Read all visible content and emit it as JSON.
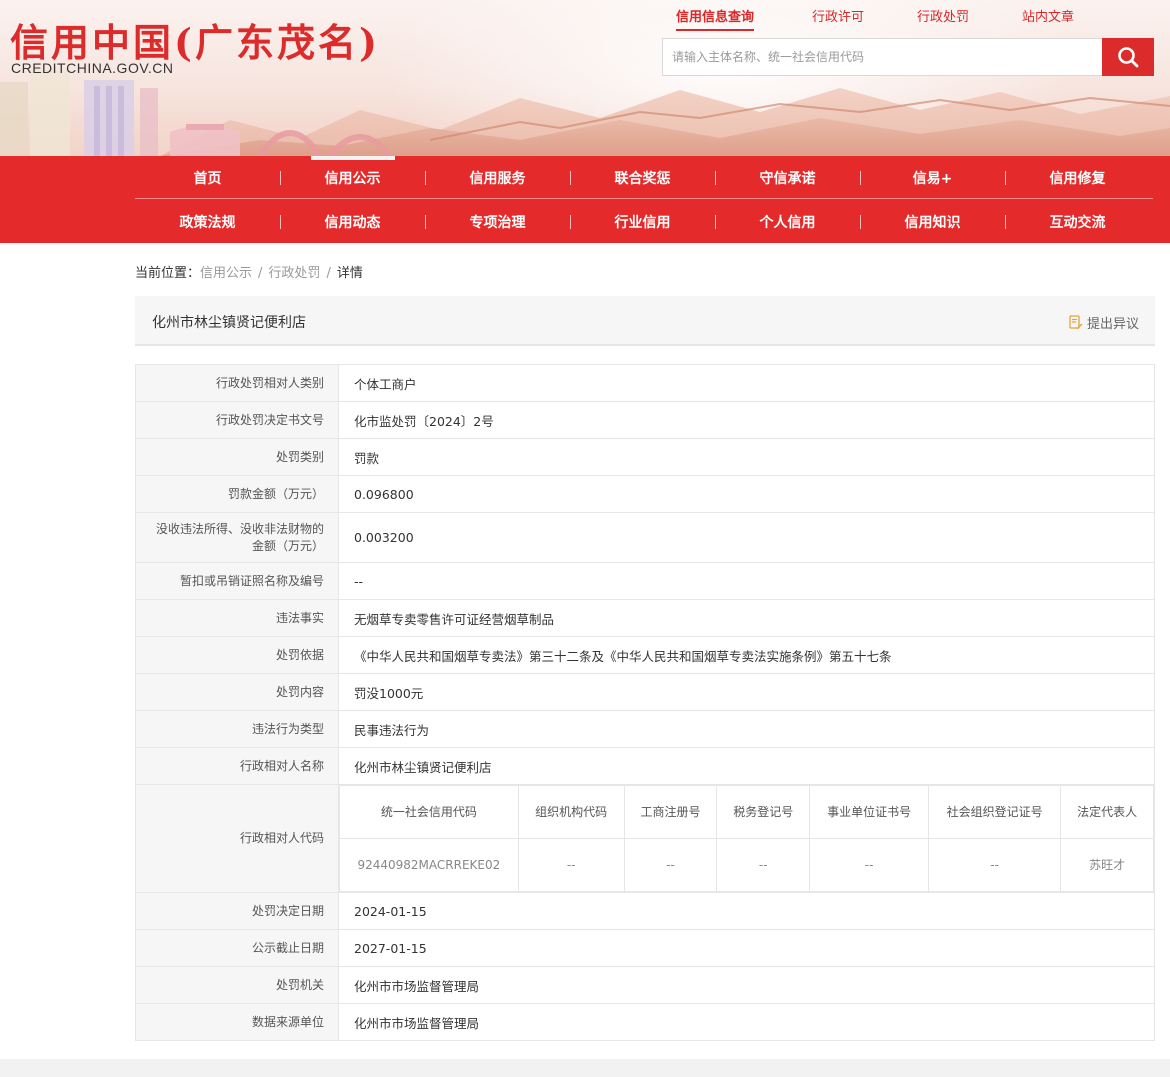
{
  "header": {
    "title": "信用中国(广东茂名)",
    "domain": "CREDITCHINA.GOV.CN",
    "top_links": [
      {
        "label": "信用信息查询",
        "active": true
      },
      {
        "label": "行政许可",
        "active": false
      },
      {
        "label": "行政处罚",
        "active": false
      },
      {
        "label": "站内文章",
        "active": false
      }
    ],
    "search": {
      "placeholder": "请输入主体名称、统一社会信用代码",
      "button_icon": "search-icon"
    }
  },
  "nav": {
    "row1": [
      "首页",
      "信用公示",
      "信用服务",
      "联合奖惩",
      "守信承诺",
      "信易+",
      "信用修复"
    ],
    "row2": [
      "政策法规",
      "信用动态",
      "专项治理",
      "行业信用",
      "个人信用",
      "信用知识",
      "互动交流"
    ],
    "active": "信用公示"
  },
  "breadcrumb": {
    "prefix": "当前位置：",
    "items": [
      "信用公示",
      "行政处罚",
      "详情"
    ]
  },
  "entity": {
    "name": "化州市林尘镇贤记便利店",
    "objection_label": "提出异议"
  },
  "details": {
    "rows_top": [
      {
        "label": "行政处罚相对人类别",
        "value": "个体工商户"
      },
      {
        "label": "行政处罚决定书文号",
        "value": "化市监处罚〔2024〕2号"
      },
      {
        "label": "处罚类别",
        "value": "罚款"
      },
      {
        "label": "罚款金额（万元）",
        "value": "0.096800"
      },
      {
        "label": "没收违法所得、没收非法财物的金额（万元）",
        "value": "0.003200"
      },
      {
        "label": "暂扣或吊销证照名称及编号",
        "value": "--"
      },
      {
        "label": "违法事实",
        "value": "无烟草专卖零售许可证经营烟草制品"
      },
      {
        "label": "处罚依据",
        "value": "《中华人民共和国烟草专卖法》第三十二条及《中华人民共和国烟草专卖法实施条例》第五十七条"
      },
      {
        "label": "处罚内容",
        "value": "罚没1000元"
      },
      {
        "label": "违法行为类型",
        "value": "民事违法行为"
      },
      {
        "label": "行政相对人名称",
        "value": "化州市林尘镇贤记便利店"
      }
    ],
    "code_block": {
      "label": "行政相对人代码",
      "headers": [
        "统一社会信用代码",
        "组织机构代码",
        "工商注册号",
        "税务登记号",
        "事业单位证书号",
        "社会组织登记证号",
        "法定代表人"
      ],
      "values": [
        "92440982MACRREKE02",
        "--",
        "--",
        "--",
        "--",
        "--",
        "苏旺才"
      ]
    },
    "rows_bottom": [
      {
        "label": "处罚决定日期",
        "value": "2024-01-15"
      },
      {
        "label": "公示截止日期",
        "value": "2027-01-15"
      },
      {
        "label": "处罚机关",
        "value": "化州市市场监督管理局"
      },
      {
        "label": "数据来源单位",
        "value": "化州市市场监督管理局"
      }
    ]
  },
  "colors": {
    "brand_red": "#e42a2b",
    "title_red": "#dc2b2b",
    "label_bg": "#f6f6f6",
    "border": "#e6e6e6"
  }
}
